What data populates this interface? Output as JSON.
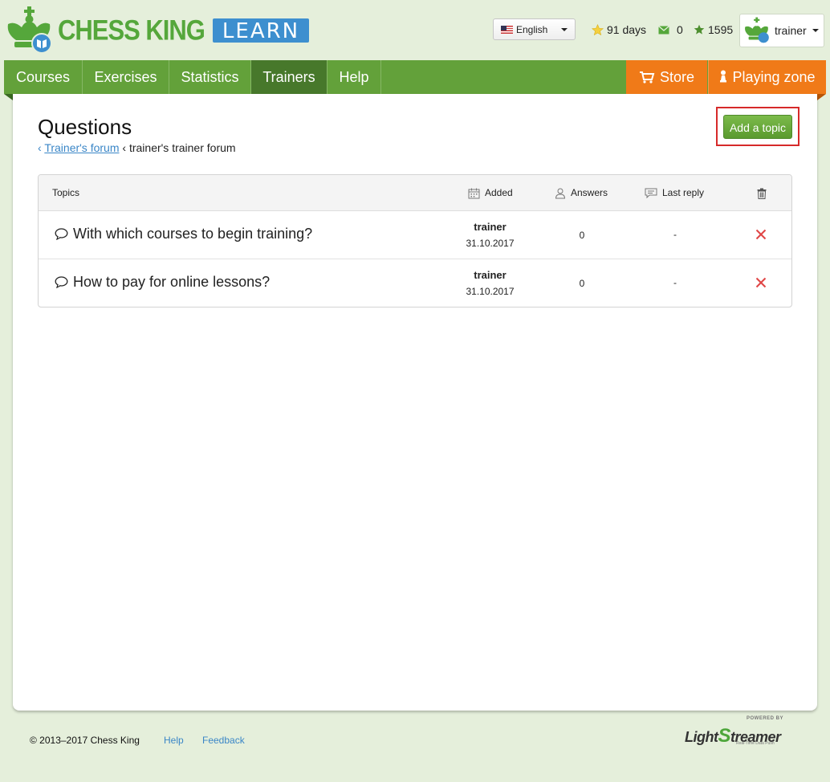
{
  "header": {
    "logo_text": "CHESS KING",
    "logo_badge": "LEARN",
    "language": "English",
    "days": "91 days",
    "messages": "0",
    "rating": "1595",
    "username": "trainer"
  },
  "nav": {
    "left": [
      "Courses",
      "Exercises",
      "Statistics",
      "Trainers",
      "Help"
    ],
    "active": "Trainers",
    "store": "Store",
    "playing_zone": "Playing zone"
  },
  "page": {
    "title": "Questions",
    "breadcrumb_link": "Trainer's forum",
    "breadcrumb_current": "trainer's trainer forum",
    "add_topic": "Add a topic"
  },
  "table": {
    "headers": {
      "topics": "Topics",
      "added": "Added",
      "answers": "Answers",
      "last_reply": "Last reply"
    },
    "rows": [
      {
        "title": "With which courses to begin training?",
        "author": "trainer",
        "date": "31.10.2017",
        "answers": "0",
        "last_reply": "-"
      },
      {
        "title": "How to pay for online lessons?",
        "author": "trainer",
        "date": "31.10.2017",
        "answers": "0",
        "last_reply": "-"
      }
    ]
  },
  "footer": {
    "copyright": "© 2013–2017 Chess King",
    "help": "Help",
    "feedback": "Feedback",
    "powered_by": "POWERED BY",
    "lightstreamer_light": "Light",
    "lightstreamer_s": "S",
    "lightstreamer_rest": "treamer",
    "lightstreamer_tag": "Real-Time Data Push"
  },
  "colors": {
    "brand_green": "#63a13a",
    "nav_active": "#47782b",
    "orange": "#f07a18",
    "link_blue": "#3a86c7",
    "delete_red": "#e04545"
  }
}
